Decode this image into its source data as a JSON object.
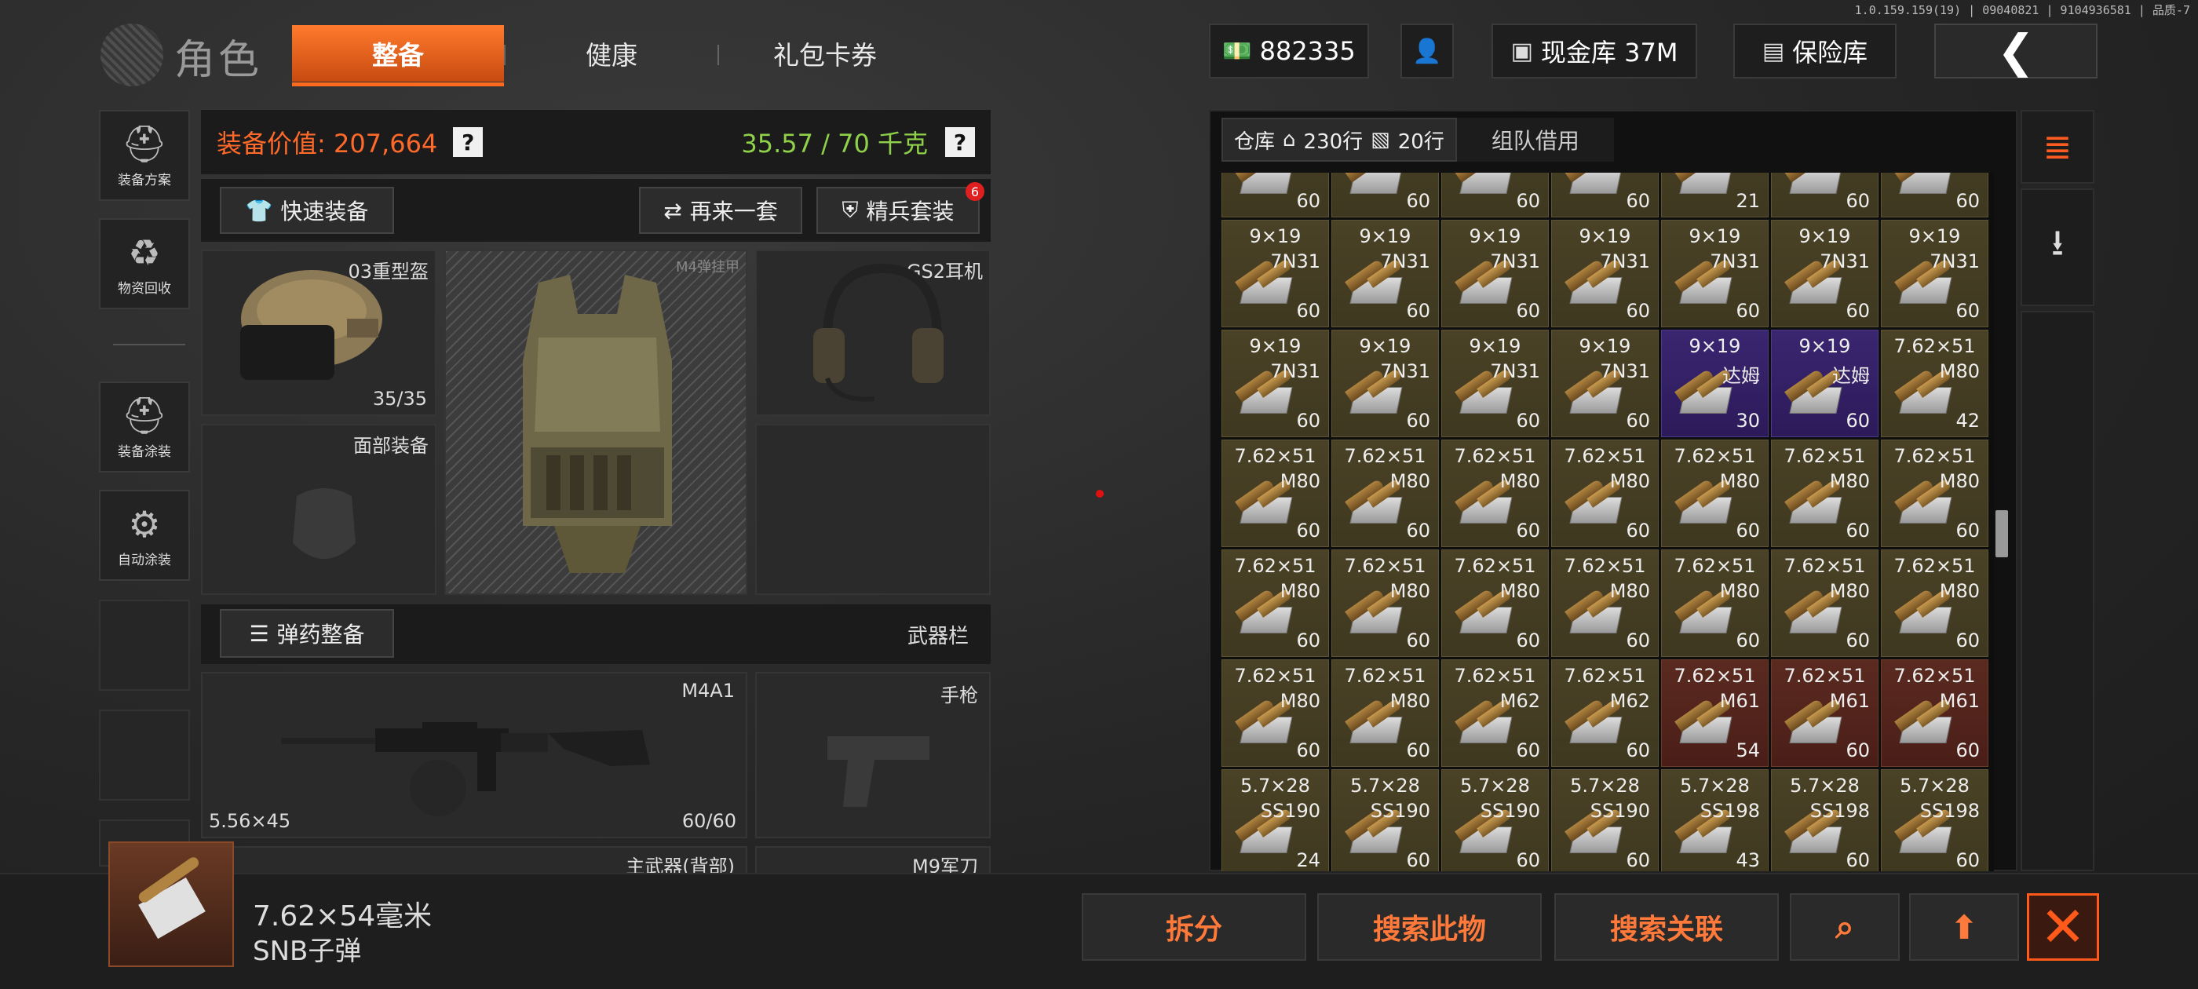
{
  "version_text": "1.0.159.159(19) | 09040821 | 9104936581 | 品质-7",
  "header": {
    "title": "角色",
    "tabs": [
      "整备",
      "健康",
      "礼包卡券"
    ],
    "currency": "882335",
    "cash_vault": "现金库 37M",
    "safe_vault": "保险库"
  },
  "sidebar": [
    {
      "label": "装备方案",
      "icon": "helmet-gear-icon"
    },
    {
      "label": "物资回收",
      "icon": "recycle-icon"
    },
    {
      "label": "装备涂装",
      "icon": "paint-helmet-icon"
    },
    {
      "label": "自动涂装",
      "icon": "auto-paint-icon"
    }
  ],
  "equipment": {
    "value_label": "装备价值: 207,664",
    "weight": "35.57 / 70 千克",
    "quick_equip": "快速装备",
    "again": "再来一套",
    "elite": "精兵套装",
    "elite_badge": "6",
    "helmet_name": "03重型盔",
    "helmet_durability": "35/35",
    "vest_name": "M4弹挂甲",
    "headset_name": "GS2耳机",
    "face_slot": "面部装备",
    "ammo_equip": "弹药整备",
    "weapon_bar": "武器栏",
    "primary_name": "M4A1",
    "primary_caliber": "5.56×45",
    "primary_ammo": "60/60",
    "pistol_slot": "手枪",
    "primary_back": "主武器(背部)",
    "knife": "M9军刀"
  },
  "warehouse": {
    "tab_label": "仓库",
    "rows_house": "230行",
    "rows_bag": "20行",
    "team_borrow": "组队借用",
    "top_counts": [
      "60",
      "60",
      "60",
      "60",
      "21",
      "60",
      "60"
    ],
    "rows": [
      [
        {
          "cal": "9×19",
          "var": "7N31",
          "cnt": "60",
          "bg": "olive"
        },
        {
          "cal": "9×19",
          "var": "7N31",
          "cnt": "60",
          "bg": "olive"
        },
        {
          "cal": "9×19",
          "var": "7N31",
          "cnt": "60",
          "bg": "olive"
        },
        {
          "cal": "9×19",
          "var": "7N31",
          "cnt": "60",
          "bg": "olive"
        },
        {
          "cal": "9×19",
          "var": "7N31",
          "cnt": "60",
          "bg": "olive"
        },
        {
          "cal": "9×19",
          "var": "7N31",
          "cnt": "60",
          "bg": "olive"
        },
        {
          "cal": "9×19",
          "var": "7N31",
          "cnt": "60",
          "bg": "olive"
        }
      ],
      [
        {
          "cal": "9×19",
          "var": "7N31",
          "cnt": "60",
          "bg": "olive"
        },
        {
          "cal": "9×19",
          "var": "7N31",
          "cnt": "60",
          "bg": "olive"
        },
        {
          "cal": "9×19",
          "var": "7N31",
          "cnt": "60",
          "bg": "olive"
        },
        {
          "cal": "9×19",
          "var": "7N31",
          "cnt": "60",
          "bg": "olive"
        },
        {
          "cal": "9×19",
          "var": "达姆",
          "cnt": "30",
          "bg": "purple"
        },
        {
          "cal": "9×19",
          "var": "达姆",
          "cnt": "60",
          "bg": "purple"
        },
        {
          "cal": "7.62×51",
          "var": "M80",
          "cnt": "42",
          "bg": "olive"
        }
      ],
      [
        {
          "cal": "7.62×51",
          "var": "M80",
          "cnt": "60",
          "bg": "olive"
        },
        {
          "cal": "7.62×51",
          "var": "M80",
          "cnt": "60",
          "bg": "olive"
        },
        {
          "cal": "7.62×51",
          "var": "M80",
          "cnt": "60",
          "bg": "olive"
        },
        {
          "cal": "7.62×51",
          "var": "M80",
          "cnt": "60",
          "bg": "olive"
        },
        {
          "cal": "7.62×51",
          "var": "M80",
          "cnt": "60",
          "bg": "olive"
        },
        {
          "cal": "7.62×51",
          "var": "M80",
          "cnt": "60",
          "bg": "olive"
        },
        {
          "cal": "7.62×51",
          "var": "M80",
          "cnt": "60",
          "bg": "olive"
        }
      ],
      [
        {
          "cal": "7.62×51",
          "var": "M80",
          "cnt": "60",
          "bg": "olive"
        },
        {
          "cal": "7.62×51",
          "var": "M80",
          "cnt": "60",
          "bg": "olive"
        },
        {
          "cal": "7.62×51",
          "var": "M80",
          "cnt": "60",
          "bg": "olive"
        },
        {
          "cal": "7.62×51",
          "var": "M80",
          "cnt": "60",
          "bg": "olive"
        },
        {
          "cal": "7.62×51",
          "var": "M80",
          "cnt": "60",
          "bg": "olive"
        },
        {
          "cal": "7.62×51",
          "var": "M80",
          "cnt": "60",
          "bg": "olive"
        },
        {
          "cal": "7.62×51",
          "var": "M80",
          "cnt": "60",
          "bg": "olive"
        }
      ],
      [
        {
          "cal": "7.62×51",
          "var": "M80",
          "cnt": "60",
          "bg": "olive"
        },
        {
          "cal": "7.62×51",
          "var": "M80",
          "cnt": "60",
          "bg": "olive"
        },
        {
          "cal": "7.62×51",
          "var": "M62",
          "cnt": "60",
          "bg": "olive"
        },
        {
          "cal": "7.62×51",
          "var": "M62",
          "cnt": "60",
          "bg": "olive"
        },
        {
          "cal": "7.62×51",
          "var": "M61",
          "cnt": "54",
          "bg": "red"
        },
        {
          "cal": "7.62×51",
          "var": "M61",
          "cnt": "60",
          "bg": "red"
        },
        {
          "cal": "7.62×51",
          "var": "M61",
          "cnt": "60",
          "bg": "red"
        }
      ],
      [
        {
          "cal": "5.7×28",
          "var": "SS190",
          "cnt": "24",
          "bg": "olive"
        },
        {
          "cal": "5.7×28",
          "var": "SS190",
          "cnt": "60",
          "bg": "olive"
        },
        {
          "cal": "5.7×28",
          "var": "SS190",
          "cnt": "60",
          "bg": "olive"
        },
        {
          "cal": "5.7×28",
          "var": "SS190",
          "cnt": "60",
          "bg": "olive"
        },
        {
          "cal": "5.7×28",
          "var": "SS198",
          "cnt": "43",
          "bg": "olive"
        },
        {
          "cal": "5.7×28",
          "var": "SS198",
          "cnt": "60",
          "bg": "olive"
        },
        {
          "cal": "5.7×28",
          "var": "SS198",
          "cnt": "60",
          "bg": "olive"
        }
      ]
    ]
  },
  "selected": {
    "name": "7.62×54毫米",
    "sub": "SNB子弹"
  },
  "actions": {
    "split": "拆分",
    "search_item": "搜索此物",
    "search_related": "搜索关联"
  },
  "colors": {
    "accent": "#ff6a1f",
    "weight_ok": "#8fd24a",
    "cell_olive": "#4a4226",
    "cell_purple": "#3a2670",
    "cell_red": "#5a2a20"
  }
}
